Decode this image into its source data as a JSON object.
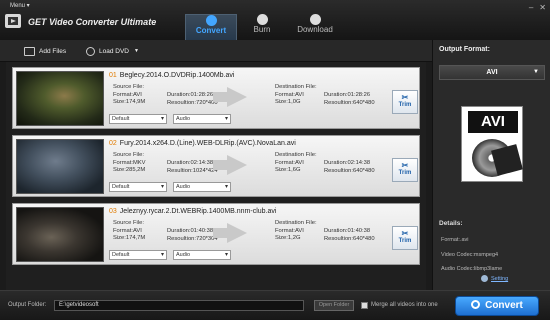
{
  "window": {
    "menu_label": "Menu",
    "title": "GET Video Converter Ultimate"
  },
  "tabs": [
    {
      "label": "Convert",
      "active": true
    },
    {
      "label": "Burn",
      "active": false
    },
    {
      "label": "Download",
      "active": false
    }
  ],
  "toolbar": {
    "add_files": "Add Files",
    "load_dvd": "Load DVD"
  },
  "files": [
    {
      "index": "01",
      "name": "Beglecy.2014.O.DVDRip.1400Mb.avi",
      "source_label": "Source File:",
      "source_format": "Format:AVI",
      "source_size": "Size:174,9M",
      "source_duration": "Duration:01:28:26",
      "source_resolution": "Resoultion:720*400",
      "dest_label": "Destination File:",
      "dest_format": "Format:AVI",
      "dest_size": "Size:1,0G",
      "dest_duration": "Duration:01:28:26",
      "dest_resolution": "Resoultion:640*480",
      "subtitle": "Default",
      "audio": "Audio",
      "trim": "Trim"
    },
    {
      "index": "02",
      "name": "Fury.2014.x264.D.(Line).WEB-DLRip.(AVC).NovaLan.avi",
      "source_label": "Source File:",
      "source_format": "Format:MKV",
      "source_size": "Size:285,2M",
      "source_duration": "Duration:02:14:38",
      "source_resolution": "Resultion:1024*424",
      "dest_label": "Destination File:",
      "dest_format": "Format:AVI",
      "dest_size": "Size:1,6G",
      "dest_duration": "Duration:02:14:38",
      "dest_resolution": "Resoultion:640*480",
      "subtitle": "Default",
      "audio": "Audio",
      "trim": "Trim"
    },
    {
      "index": "03",
      "name": "Jeleznyy.rycar.2.Dt.WEBRip.1400MB.nnm-club.avi",
      "source_label": "Source File:",
      "source_format": "Format:AVI",
      "source_size": "Size:174,7M",
      "source_duration": "Duration:01:40:38",
      "source_resolution": "Resoultion:720*304",
      "dest_label": "Destination File:",
      "dest_format": "Format:AVI",
      "dest_size": "Size:1,2G",
      "dest_duration": "Duration:01:40:38",
      "dest_resolution": "Resoultion:640*480",
      "subtitle": "Default",
      "audio": "Audio",
      "trim": "Trim"
    }
  ],
  "output_panel": {
    "label": "Output Format:",
    "format": "AVI",
    "icon_text": "AVI",
    "details_label": "Details:",
    "detail_format": "Format:.avi",
    "detail_video": "Video Codec:msmpeg4",
    "detail_audio": "Audio Codec:libmp3lame",
    "setting": "Setting"
  },
  "bottom": {
    "output_folder_label": "Output Folder:",
    "output_path": "E:\\getvideosoft",
    "open_folder": "Open Folder",
    "merge_label": "Merge all videos into one",
    "convert": "Convert"
  },
  "colors": {
    "accent": "#43a6ff",
    "convert_button": "#2f8ae8",
    "index_number": "#e07b00"
  }
}
